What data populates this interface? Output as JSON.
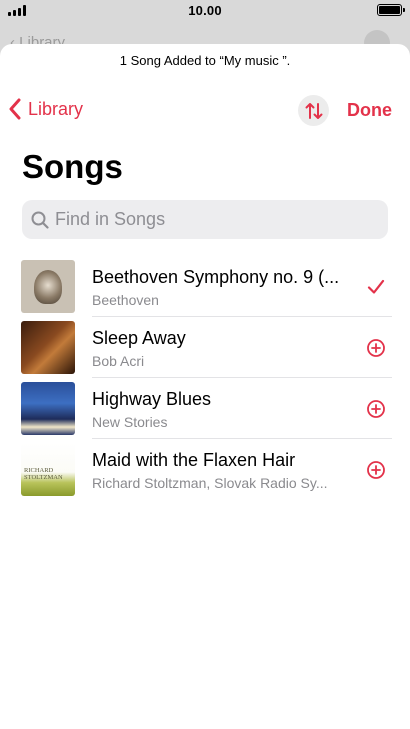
{
  "status": {
    "time": "10.00"
  },
  "background_screen": {
    "back_label": "Library"
  },
  "banner": "1 Song Added to “My music ”.",
  "nav": {
    "back_label": "Library",
    "done_label": "Done"
  },
  "page_title": "Songs",
  "search": {
    "placeholder": "Find in Songs",
    "value": ""
  },
  "accent_color": "#e3324a",
  "songs": [
    {
      "title": "Beethoven Symphony no. 9 (...",
      "artist": "Beethoven",
      "state": "added",
      "action_icon": "checkmark-icon"
    },
    {
      "title": "Sleep Away",
      "artist": "Bob Acri",
      "state": "not-added",
      "action_icon": "add-circle-icon"
    },
    {
      "title": "Highway Blues",
      "artist": "New Stories",
      "state": "not-added",
      "action_icon": "add-circle-icon"
    },
    {
      "title": "Maid with the Flaxen Hair",
      "artist": "Richard Stoltzman, Slovak Radio Sy...",
      "state": "not-added",
      "action_icon": "add-circle-icon"
    }
  ],
  "artwork_text": {
    "album4": "RICHARD\nSTOLTZMAN"
  }
}
